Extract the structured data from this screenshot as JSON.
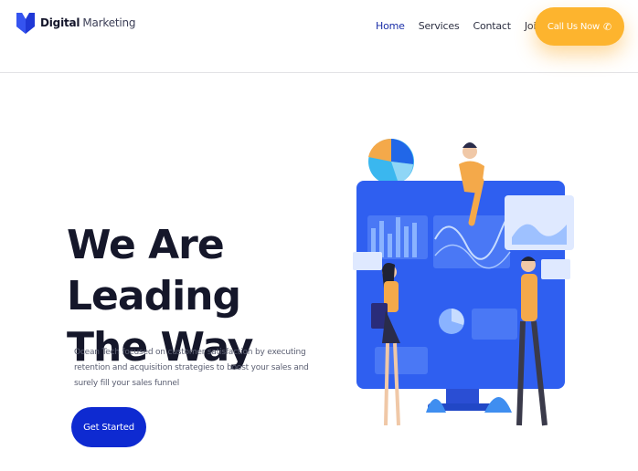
{
  "header": {
    "brand_bold": "Digital",
    "brand_light": "Marketing",
    "logo_icon": "v-shield-logo-icon"
  },
  "nav": {
    "items": [
      {
        "label": "Home",
        "active": true
      },
      {
        "label": "Services",
        "active": false
      },
      {
        "label": "Contact",
        "active": false
      },
      {
        "label": "Join Us",
        "active": false
      }
    ],
    "call_button": {
      "label": "Call Us Now",
      "icon": "phone-icon"
    }
  },
  "hero": {
    "title_line1": "We Are Leading",
    "title_line2": "The Way",
    "description": "Ocean Tech focused on customer satisfaction by executing retention and acquisition strategies to boost your sales and surely fill your sales funnel",
    "cta_label": "Get Started"
  },
  "colors": {
    "accent_blue": "#0e2ad1",
    "nav_active": "#1b2fa8",
    "call_orange": "#fdb42e",
    "illustration_blue": "#3b63f0"
  }
}
